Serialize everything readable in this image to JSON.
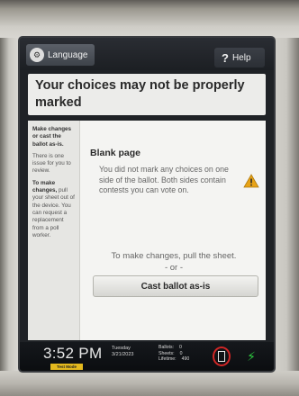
{
  "topbar": {
    "language_label": "Language",
    "help_label": "Help"
  },
  "header": {
    "title": "Your choices may not be properly marked"
  },
  "sidebar": {
    "heading": "Make changes or cast the ballot as-is.",
    "issue_text": "There is one issue for you to review.",
    "instruction_bold": "To make changes,",
    "instruction_text": "pull your sheet out of the device. You can request a replacement from a poll worker."
  },
  "main": {
    "heading": "Blank page",
    "message": "You did not mark any choices on one side of the ballot. Both sides contain contests you can vote on.",
    "instruction": "To make changes, pull the sheet.",
    "or_text": "- or -",
    "cast_button_label": "Cast ballot as-is"
  },
  "status": {
    "time": "3:52 PM",
    "mode": "Test Mode",
    "day": "Tuesday",
    "date": "3/21/2023",
    "ballots_label": "Ballots:",
    "ballots_value": "0",
    "sheets_label": "Sheets:",
    "sheets_value": "0",
    "lifetime_label": "Lifetime:",
    "lifetime_value": "490"
  },
  "colors": {
    "warning": "#e8a317",
    "mode_badge": "#e4b91e",
    "printer_ring": "#d02626",
    "power": "#2ecc40"
  },
  "icons": [
    "language-icon",
    "help-icon",
    "warning-icon",
    "printer-icon",
    "power-icon"
  ]
}
